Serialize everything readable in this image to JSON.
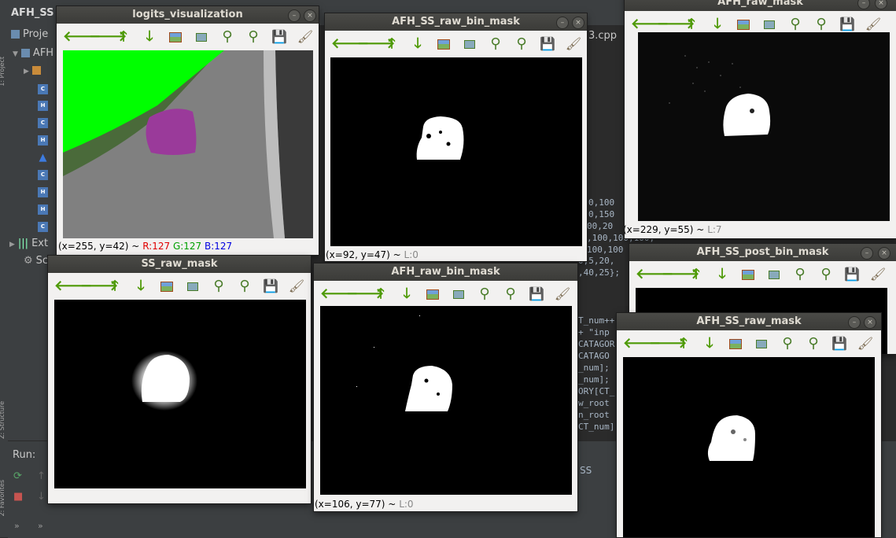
{
  "ide": {
    "title": "AFH_SS",
    "project_header": "Proje",
    "project_root": "AFH",
    "external_libs": "Ext",
    "scratches": "Sc",
    "file_tab": "3.cpp",
    "left_strip_top": "1: Project",
    "left_strip_mid": "Z: Structure",
    "left_strip_bot": "2: Favorites",
    "code_lines": [
      "0,100",
      "0,150",
      "00,20",
      ",100,100,100,",
      "100,100",
      "0,5,20,",
      ",40,25};",
      "T_num++",
      " + \"inp",
      "CATAGOR",
      " CATAGO",
      "_num];",
      "_num];",
      "ORY[CT_",
      "w_root",
      "n_root",
      "CT_num]"
    ],
    "run_label": "Run:",
    "run_output": "SS",
    "collapse_left": "»",
    "collapse_right": "»"
  },
  "toolbar_icons": [
    "arrow-left-icon",
    "arrow-right-icon",
    "arrow-up-icon",
    "arrow-down-icon",
    "image-icon",
    "zoom-image-icon",
    "zoom-in-icon",
    "zoom-out-icon",
    "save-icon",
    "clear-icon"
  ],
  "windows": {
    "logits": {
      "title": "logits_visualization",
      "status_coord": "(x=255, y=42) ~",
      "status_r": "R:127",
      "status_g": "G:127",
      "status_b": "B:127",
      "colors": {
        "green": "#00ff00",
        "blob": "#9a3a9a",
        "bg": "#808080"
      }
    },
    "afh_ss_raw_bin_mask": {
      "title": "AFH_SS_raw_bin_mask",
      "status_coord": "(x=92, y=47) ~",
      "status_level": "L:0"
    },
    "afh_raw_mask": {
      "title": "AFH_raw_mask",
      "status_coord": "(x=229, y=55) ~",
      "status_level": "L:7"
    },
    "ss_raw_mask": {
      "title": "SS_raw_mask"
    },
    "afh_raw_bin_mask": {
      "title": "AFH_raw_bin_mask",
      "status_coord": "(x=106, y=77) ~",
      "status_level": "L:0"
    },
    "afh_ss_post_bin_mask": {
      "title": "AFH_SS_post_bin_mask"
    },
    "afh_ss_raw_mask": {
      "title": "AFH_SS_raw_mask"
    }
  },
  "window_controls": {
    "minimize": "–",
    "close": "×"
  }
}
